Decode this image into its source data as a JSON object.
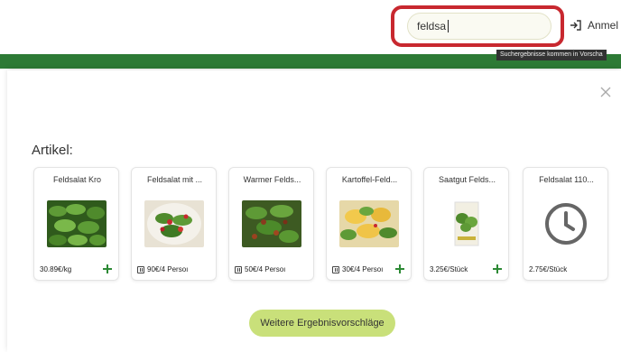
{
  "header": {
    "search": {
      "value": "feldsa",
      "tooltip": "Suchergebnisse kommen in Vorscha"
    },
    "login_label": "Anmel"
  },
  "results": {
    "section_title": "Artikel:",
    "items": [
      {
        "title": "Feldsalat Kro",
        "price": "30.89€/kg",
        "image": "lambs-lettuce-photo",
        "has_add": true,
        "is_recipe": false
      },
      {
        "title": "Feldsalat mit ...",
        "price": "90€/4 Persoı",
        "image": "salad-with-strawberries-photo",
        "has_add": false,
        "is_recipe": true
      },
      {
        "title": "Warmer Felds...",
        "price": "50€/4 Persoı",
        "image": "warm-lambs-lettuce-photo",
        "has_add": false,
        "is_recipe": true
      },
      {
        "title": "Kartoffel-Feld...",
        "price": "30€/4 Persoı",
        "image": "potato-lambs-lettuce-photo",
        "has_add": true,
        "is_recipe": true
      },
      {
        "title": "Saatgut Felds...",
        "price": "3.25€/Stück",
        "image": "seed-packet-photo",
        "has_add": true,
        "is_recipe": false
      },
      {
        "title": "Feldsalat 110...",
        "price": "2.75€/Stück",
        "image": "clock-placeholder-icon",
        "has_add": false,
        "is_recipe": false
      }
    ],
    "more_button": "Weitere Ergebnisvorschläge"
  },
  "colors": {
    "brand_green": "#2d7a35",
    "highlight_red": "#c8282f",
    "button_lime": "#c9e07a"
  }
}
